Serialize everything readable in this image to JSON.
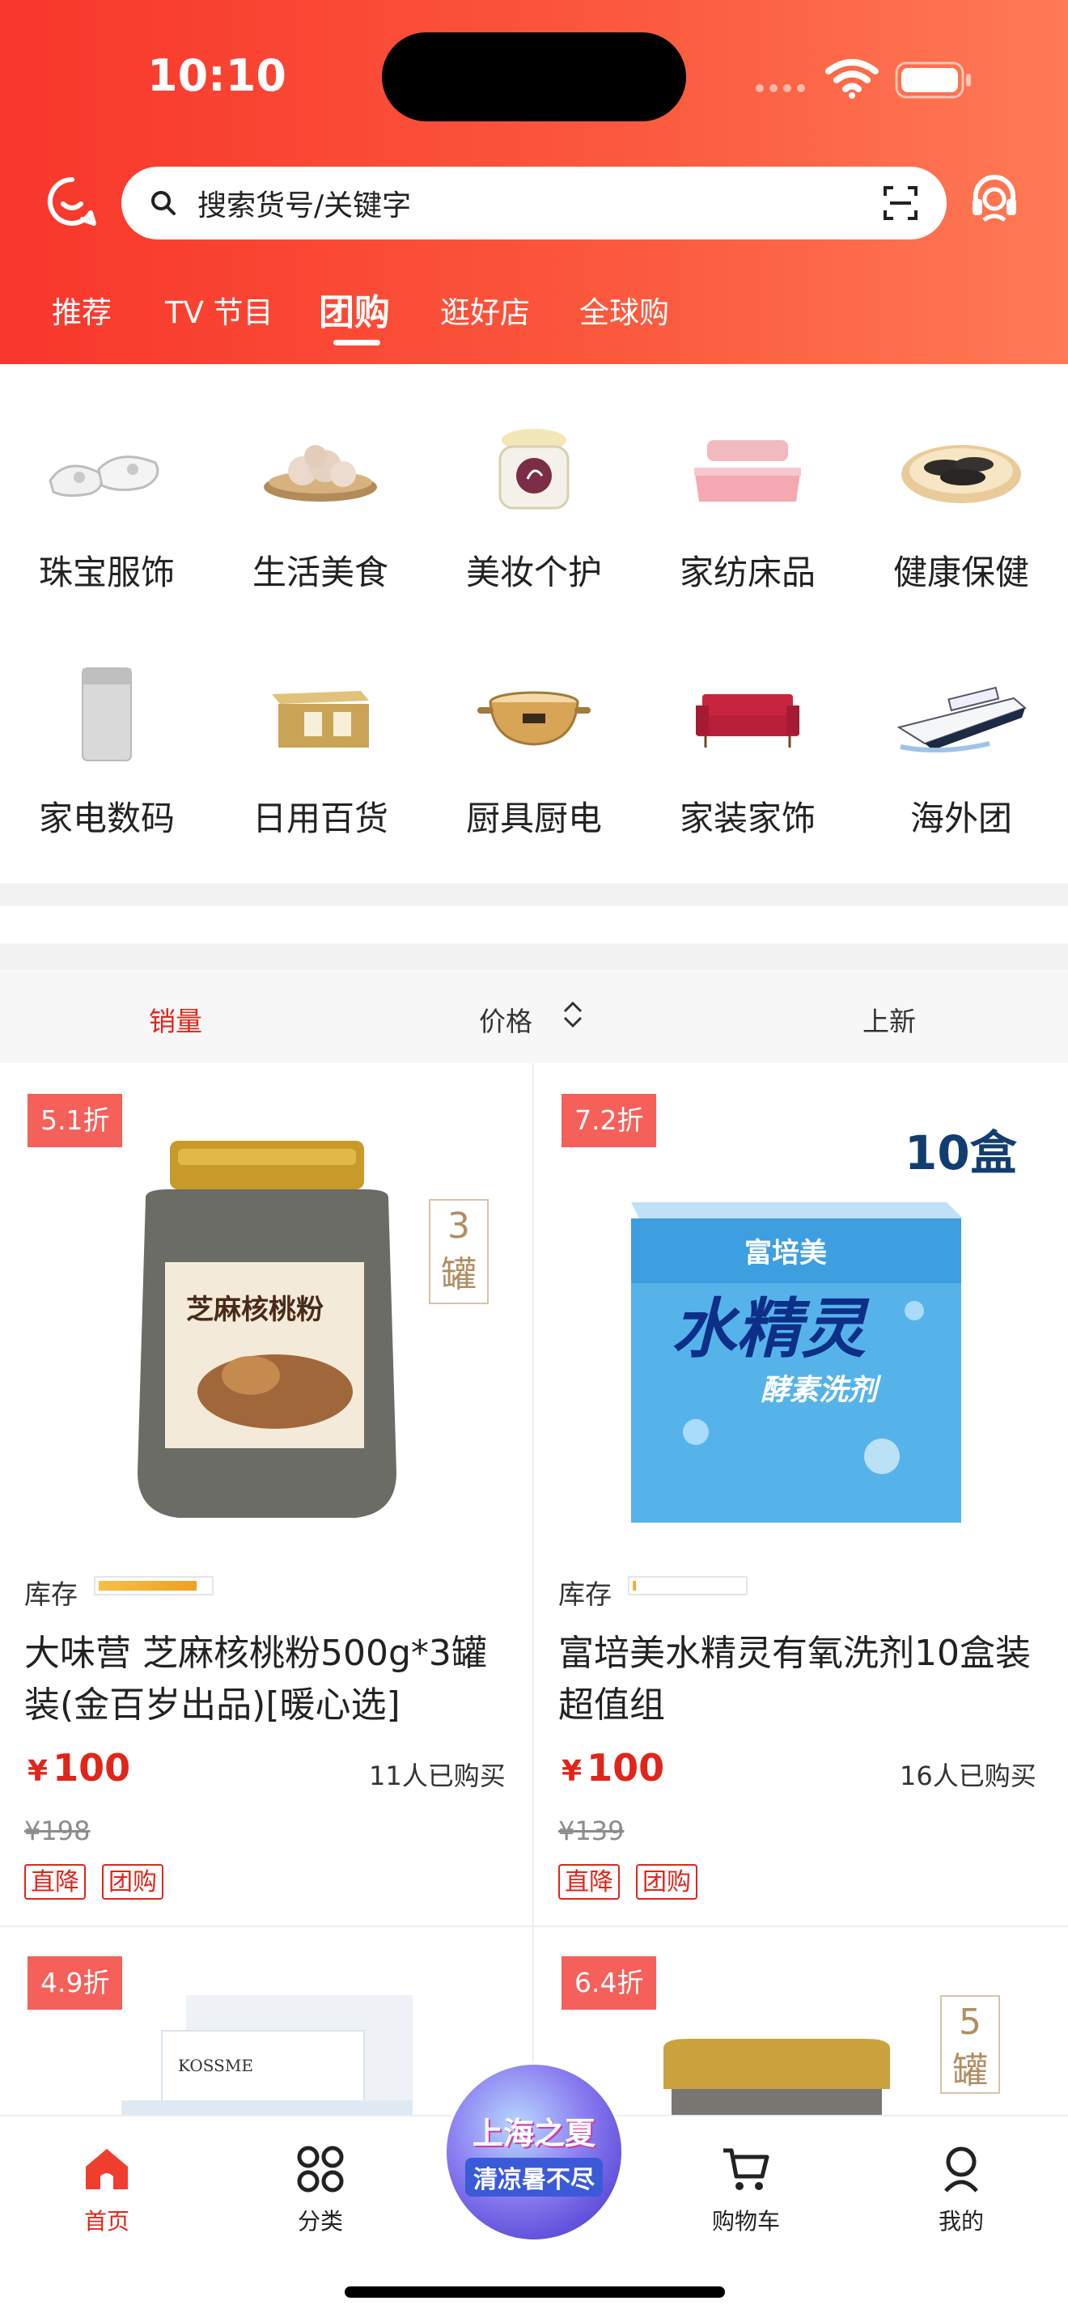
{
  "status": {
    "time": "10:10"
  },
  "header": {
    "search_placeholder": "搜索货号/关键字",
    "tabs": [
      "推荐",
      "TV 节目",
      "团购",
      "逛好店",
      "全球购"
    ],
    "active_tab": "团购"
  },
  "categories": [
    {
      "label": "珠宝服饰",
      "icon": "shoes-icon"
    },
    {
      "label": "生活美食",
      "icon": "shrimp-icon"
    },
    {
      "label": "美妆个护",
      "icon": "cream-jar-icon"
    },
    {
      "label": "家纺床品",
      "icon": "bedding-icon"
    },
    {
      "label": "健康保健",
      "icon": "sea-cucumber-icon"
    },
    {
      "label": "家电数码",
      "icon": "washing-machine-icon"
    },
    {
      "label": "日用百货",
      "icon": "gift-box-icon"
    },
    {
      "label": "厨具厨电",
      "icon": "cooking-pot-icon"
    },
    {
      "label": "家装家饰",
      "icon": "sofa-icon"
    },
    {
      "label": "海外团",
      "icon": "cruise-ship-icon"
    }
  ],
  "sort": {
    "sales": "销量",
    "price": "价格",
    "new": "上新"
  },
  "products": [
    {
      "discount": "5.1折",
      "stock_label": "库存",
      "stock_level": 0.92,
      "title": "大味营 芝麻核桃粉500g*3罐装(金百岁出品)[暖心选]",
      "currency": "¥",
      "price": "100",
      "buyers": "11人已购买",
      "original_price": "¥198",
      "tags": [
        "直降",
        "团购"
      ],
      "qty_badge": [
        "3",
        "罐"
      ],
      "image_text": "芝麻核桃粉"
    },
    {
      "discount": "7.2折",
      "stock_label": "库存",
      "stock_level": 0.03,
      "title": "富培美水精灵有氧洗剂10盒装超值组",
      "currency": "¥",
      "price": "100",
      "buyers": "16人已购买",
      "original_price": "¥139",
      "tags": [
        "直降",
        "团购"
      ],
      "box_count": "10盒",
      "image_text": "水精灵",
      "image_subtext": "酵素洗剂",
      "image_brand": "富培美"
    },
    {
      "discount": "4.9折",
      "image_brand": "KOSSME"
    },
    {
      "discount": "6.4折",
      "qty_badge": [
        "5",
        "罐"
      ]
    }
  ],
  "bottom_nav": {
    "home": "首页",
    "category": "分类",
    "cart": "购物车",
    "mine": "我的",
    "promo_line1": "上海之夏",
    "promo_line2": "清凉暑不尽"
  },
  "colors": {
    "brand_red": "#e1251b",
    "header_gradient_start": "#f8362b",
    "header_gradient_end": "#ff7a56"
  }
}
